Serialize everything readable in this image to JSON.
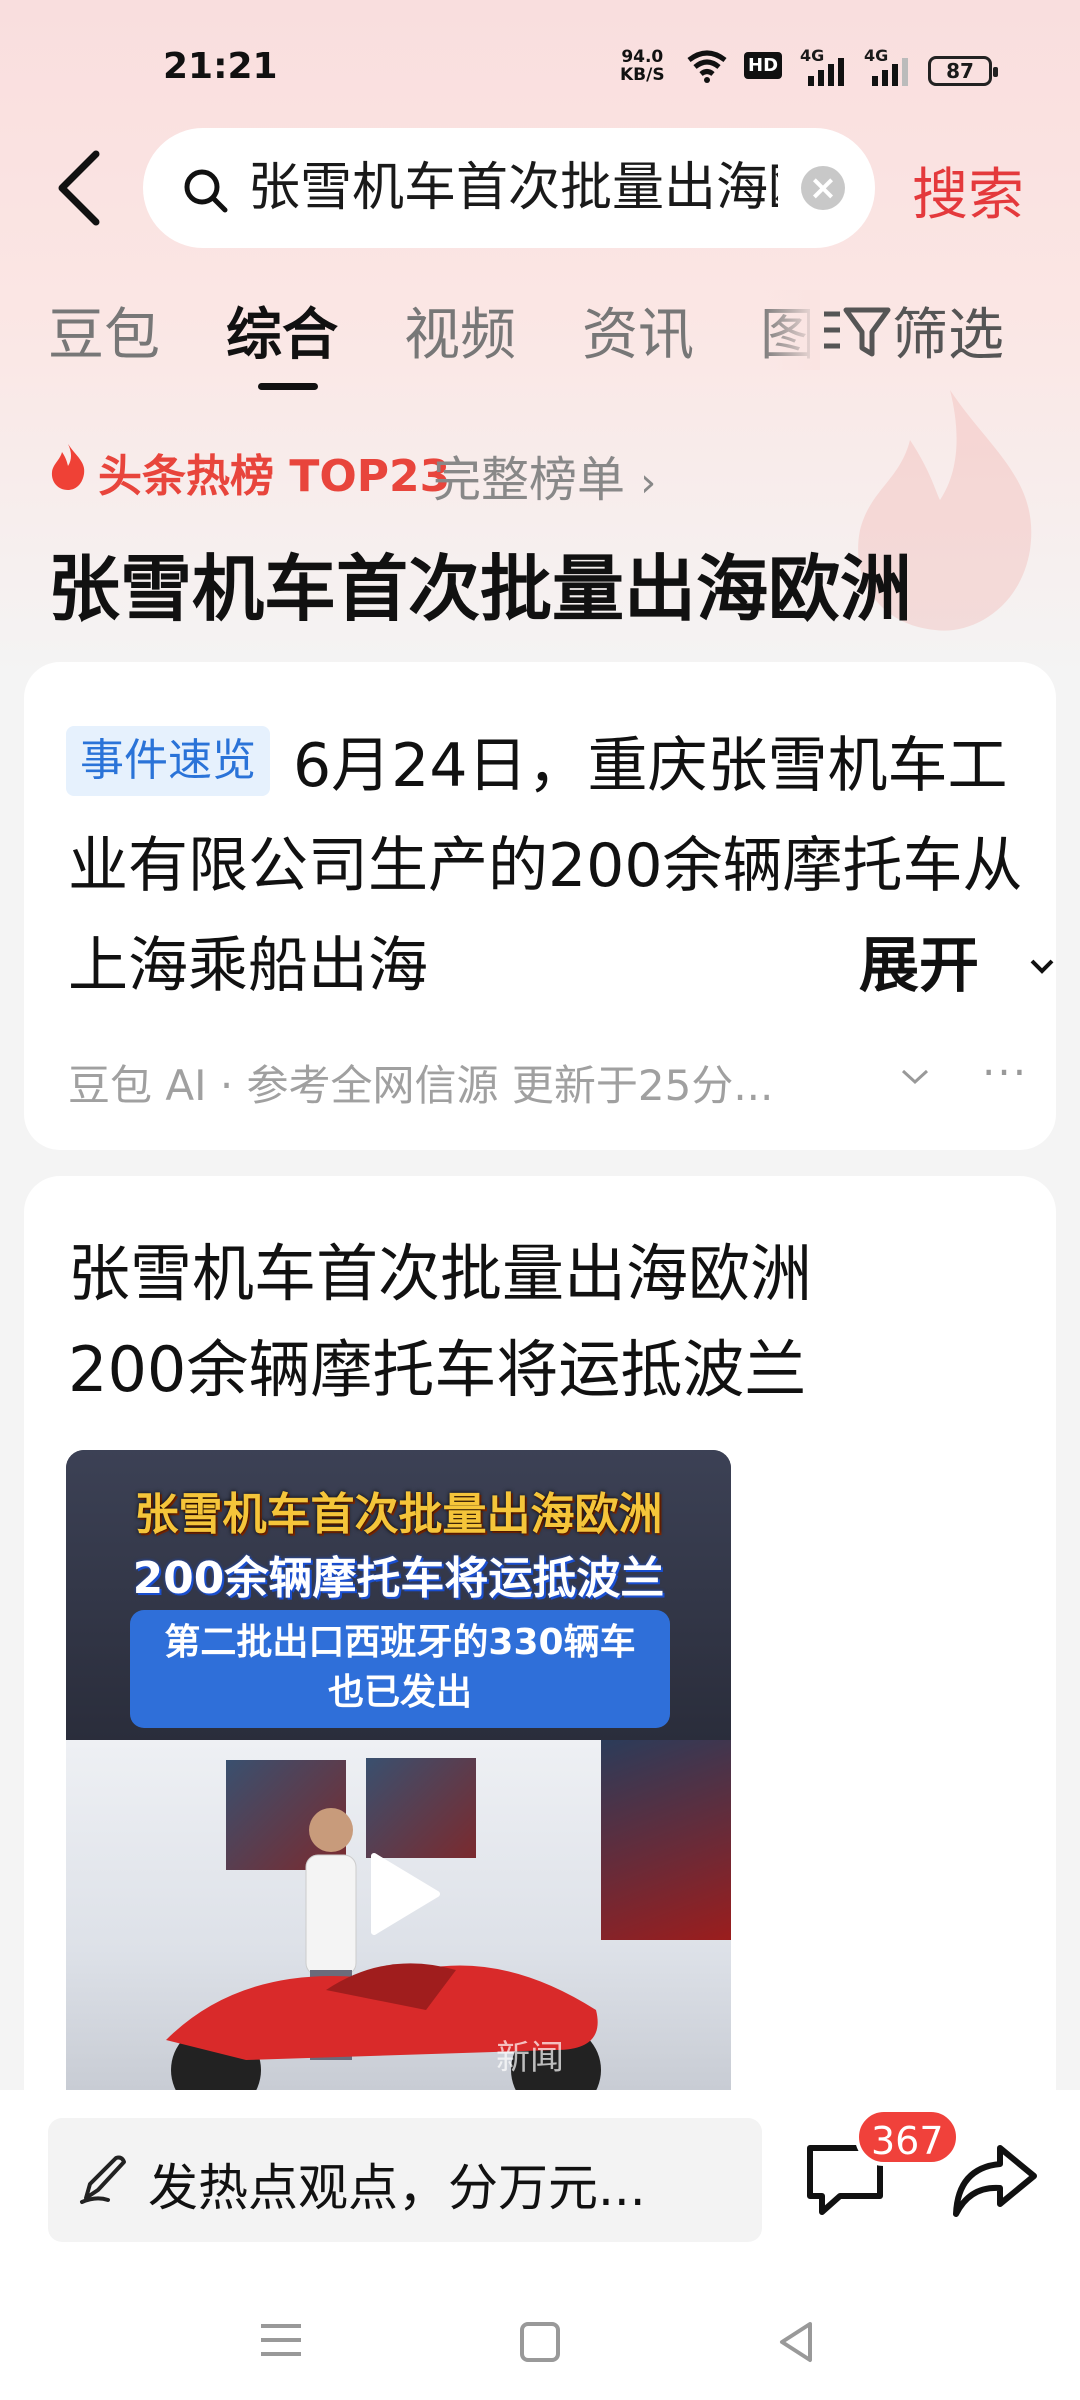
{
  "status_bar": {
    "time": "21:21",
    "net_speed": "94.0",
    "net_unit": "KB/S",
    "hd": "HD",
    "signal1": "4G",
    "signal2": "4G",
    "battery": "87"
  },
  "search": {
    "query": "张雪机车首次批量出海欧洲",
    "button": "搜索"
  },
  "tabs": [
    "豆包",
    "综合",
    "视频",
    "资讯",
    "图"
  ],
  "active_tab": "综合",
  "filter_label": "筛选",
  "hot": {
    "label": "头条热榜 TOP23",
    "full_list": "完整榜单",
    "title": "张雪机车首次批量出海欧洲"
  },
  "summary": {
    "tag": "事件速览",
    "text": "6月24日，重庆张雪机车工业有限公司生产的200余辆摩托车从上海乘船出海",
    "expand": "展开",
    "source": "豆包 AI · 参考全网信源 更新于25分..."
  },
  "news": {
    "title_line1": "张雪机车首次批量出海欧洲",
    "title_line2": "200余辆摩托车将运抵波兰",
    "video_caption1": "张雪机车首次批量出海欧洲",
    "video_caption2": "200余辆摩托车将运抵波兰",
    "video_box_line1": "第二批出口西班牙的330辆车",
    "video_box_line2": "也已发出",
    "watermark": "新闻"
  },
  "bottom": {
    "comment_placeholder": "发热点观点，分万元...",
    "comment_count": "367"
  },
  "colors": {
    "accent_red": "#e4393c",
    "tag_blue": "#2a73d8",
    "hot_red": "#e8453c"
  }
}
